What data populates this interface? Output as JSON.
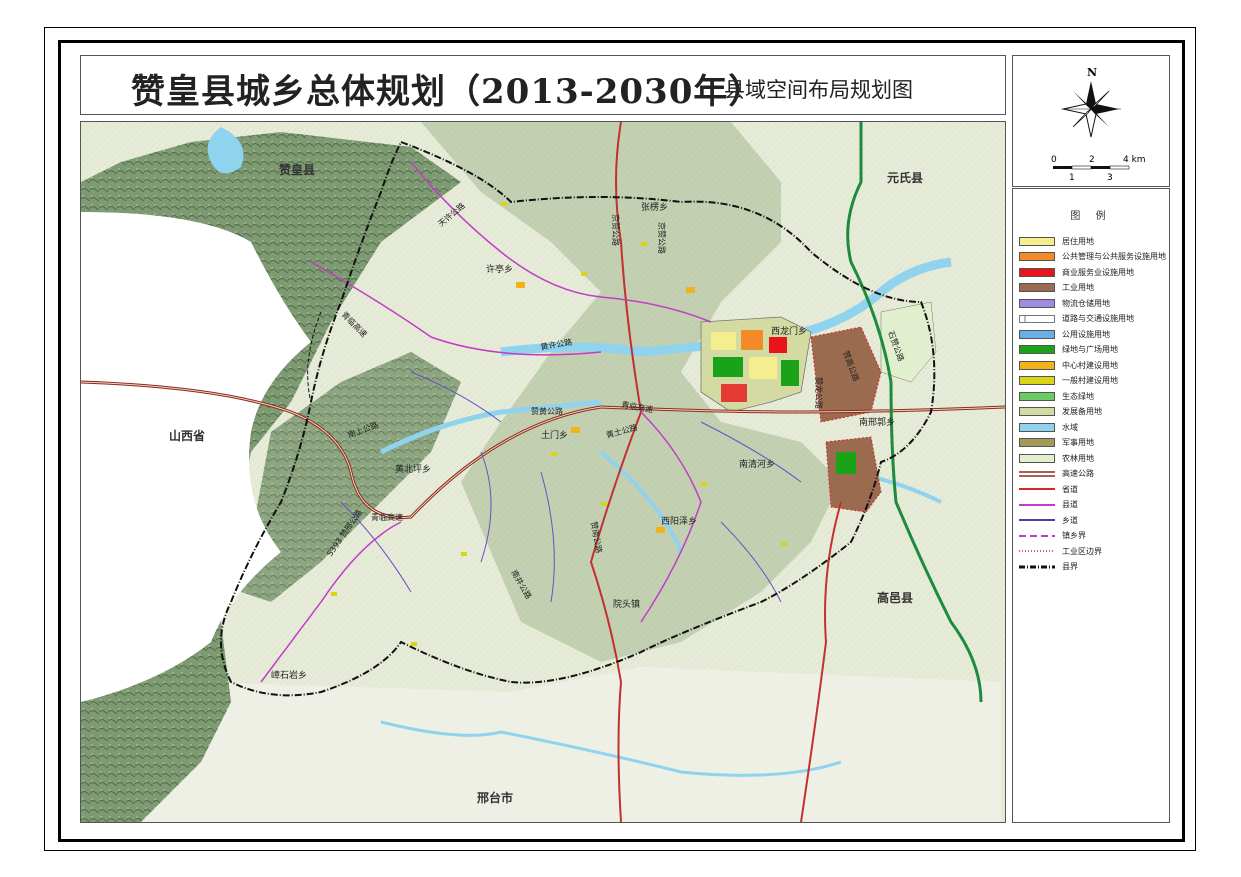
{
  "title": {
    "main": "赞皇县城乡总体规划（2013-2030年）",
    "sub": "县域空间布局规划图"
  },
  "compass": {
    "north": "N",
    "scale_top": [
      "0",
      "2",
      "4 km"
    ],
    "scale_bottom": [
      "1",
      "3"
    ]
  },
  "legend": {
    "title": "图 例",
    "items": [
      {
        "label": "居住用地",
        "color": "#f5ee8e",
        "kind": "fill"
      },
      {
        "label": "公共管理与公共服务设施用地",
        "color": "#f28a2a",
        "kind": "fill"
      },
      {
        "label": "商业服务业设施用地",
        "color": "#e8141a",
        "kind": "fill"
      },
      {
        "label": "工业用地",
        "color": "#9b6b4f",
        "kind": "fill"
      },
      {
        "label": "物流仓储用地",
        "color": "#a08ae0",
        "kind": "fill"
      },
      {
        "label": "道路与交通设施用地",
        "color": "#ffffff",
        "kind": "road-white"
      },
      {
        "label": "公用设施用地",
        "color": "#6aaee8",
        "kind": "fill"
      },
      {
        "label": "绿地与广场用地",
        "color": "#1aa318",
        "kind": "fill"
      },
      {
        "label": "中心村建设用地",
        "color": "#f2b21a",
        "kind": "fill"
      },
      {
        "label": "一般村建设用地",
        "color": "#d8d41a",
        "kind": "fill"
      },
      {
        "label": "生态绿地",
        "color": "#6acc63",
        "kind": "fill"
      },
      {
        "label": "发展备用地",
        "color": "#d3dba2",
        "kind": "fill"
      },
      {
        "label": "水域",
        "color": "#8fd3ef",
        "kind": "fill"
      },
      {
        "label": "军事用地",
        "color": "#a59a55",
        "kind": "fill"
      },
      {
        "label": "农林用地",
        "color": "#e2efcf",
        "kind": "fill"
      },
      {
        "label": "高速公路",
        "color": "#8b2c18",
        "kind": "double"
      },
      {
        "label": "省道",
        "color": "#d8262e",
        "kind": "line"
      },
      {
        "label": "县道",
        "color": "#c23cc8",
        "kind": "line"
      },
      {
        "label": "乡道",
        "color": "#4a3fa6",
        "kind": "line"
      },
      {
        "label": "镇乡界",
        "color": "#c23cc8",
        "kind": "dash"
      },
      {
        "label": "工业区边界",
        "color": "#d8262e",
        "kind": "dots"
      },
      {
        "label": "县界",
        "color": "#111111",
        "kind": "dashdot"
      }
    ]
  },
  "map": {
    "neighbors": [
      "赞皇县",
      "元氏县",
      "山西省",
      "高邑县",
      "邢台市"
    ],
    "towns": [
      "许亭乡",
      "张楞乡",
      "西龙门乡",
      "南邢郭乡",
      "院头镇",
      "西阳泽乡",
      "南清河乡",
      "土门乡",
      "黄北坪乡",
      "嶂石岩乡"
    ],
    "roads": [
      "天许公路",
      "黄许公路",
      "赞黄公路",
      "京赞公路",
      "京赞公路",
      "赞龙公路",
      "赞高公路",
      "石赞公路",
      "南上公路",
      "黄土公路",
      "赞南公路",
      "南井公路",
      "青临高速",
      "青临高速",
      "青临高速",
      "S393 赞邢公路"
    ]
  },
  "colors": {
    "mountain": "#6f8f66",
    "plain": "#e4ead3",
    "water": "#8fd3ef",
    "county_border": "#111111"
  }
}
